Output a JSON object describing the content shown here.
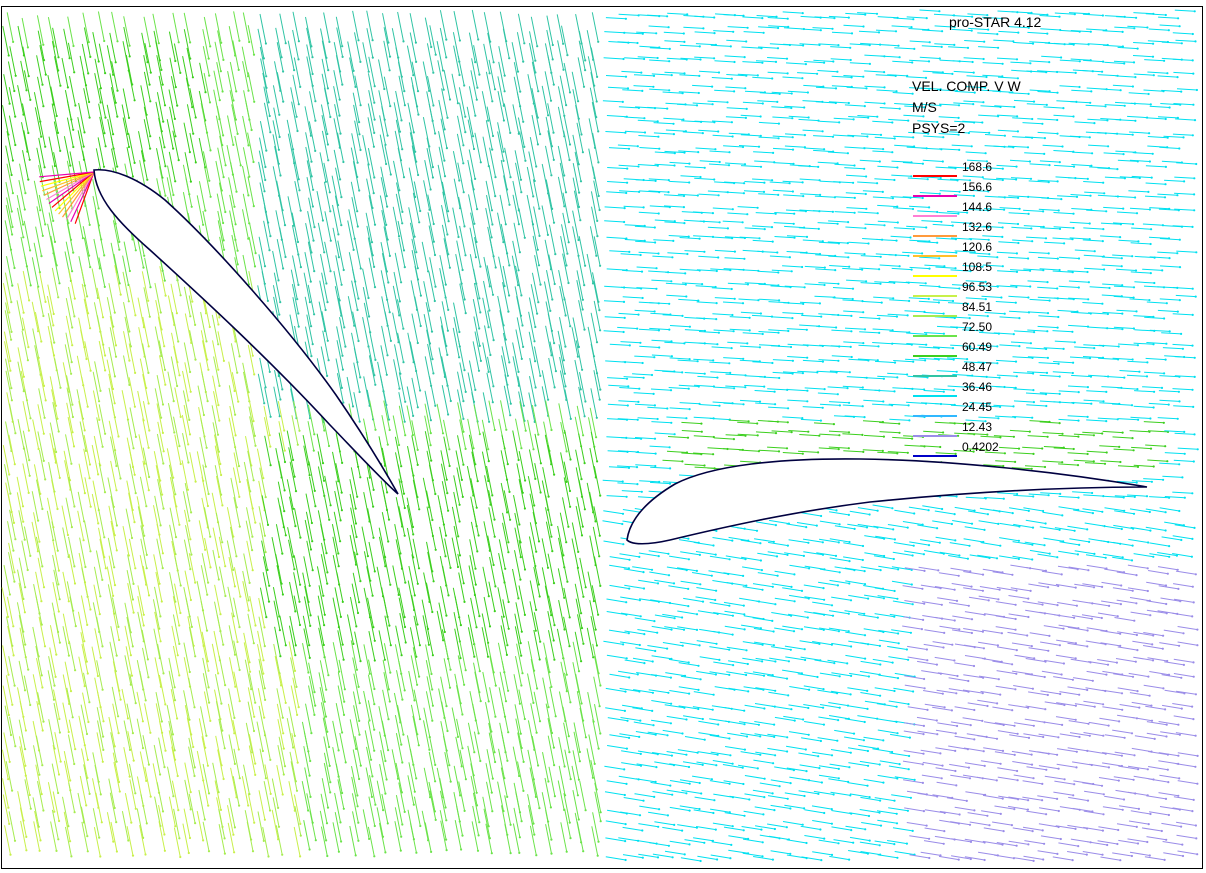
{
  "header": {
    "app_version": "pro-STAR 4.12"
  },
  "legend": {
    "quantity": "VEL. COMP. V W",
    "units": "M/S",
    "psys": "PSYS=2",
    "levels": [
      {
        "label": "168.6",
        "color": "#ff0000"
      },
      {
        "label": "156.6",
        "color": "#e800b0"
      },
      {
        "label": "144.6",
        "color": "#ff7fd4"
      },
      {
        "label": "132.6",
        "color": "#ff9a3c"
      },
      {
        "label": "120.6",
        "color": "#ffc02a"
      },
      {
        "label": "108.5",
        "color": "#ffff00"
      },
      {
        "label": "96.53",
        "color": "#c8f04a"
      },
      {
        "label": "84.51",
        "color": "#a6ec50"
      },
      {
        "label": "72.50",
        "color": "#6be34a"
      },
      {
        "label": "60.49",
        "color": "#3ccf1e"
      },
      {
        "label": "48.47",
        "color": "#30c4a4"
      },
      {
        "label": "36.46",
        "color": "#00e0f0"
      },
      {
        "label": "24.45",
        "color": "#30b8ff"
      },
      {
        "label": "12.43",
        "color": "#9a8ce8"
      },
      {
        "label": "0.4202",
        "color": "#0000c8"
      }
    ]
  },
  "colors": {
    "frame": "#000000",
    "airfoil_outline": "#000040"
  }
}
